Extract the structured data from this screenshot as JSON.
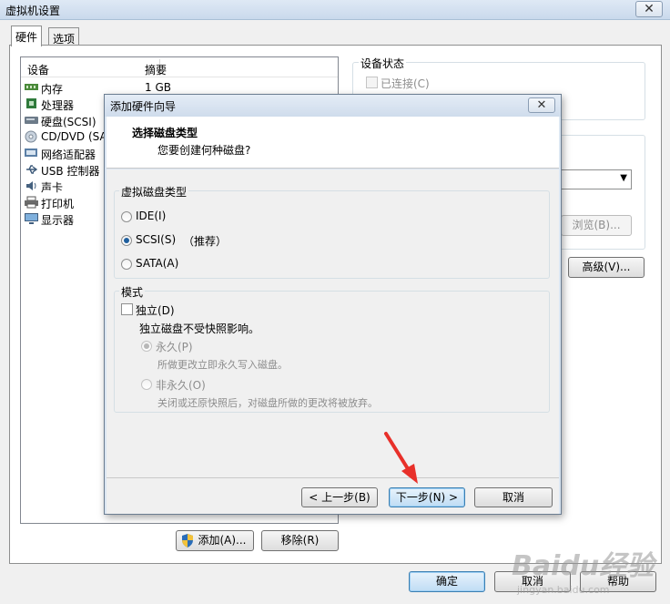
{
  "outer": {
    "title": "虚拟机设置",
    "close": "✕",
    "tabs": [
      "硬件",
      "选项"
    ],
    "device_list": {
      "headers": [
        "设备",
        "摘要"
      ],
      "rows": [
        {
          "name": "内存",
          "summary": "1 GB",
          "icon": "memory-icon"
        },
        {
          "name": "处理器",
          "summary": "",
          "icon": "processor-icon"
        },
        {
          "name": "硬盘(SCSI)",
          "summary": "",
          "icon": "hard-disk-icon"
        },
        {
          "name": "CD/DVD (SA",
          "summary": "",
          "icon": "cd-dvd-icon"
        },
        {
          "name": "网络适配器",
          "summary": "",
          "icon": "network-adapter-icon"
        },
        {
          "name": "USB 控制器",
          "summary": "",
          "icon": "usb-icon"
        },
        {
          "name": "声卡",
          "summary": "",
          "icon": "sound-card-icon"
        },
        {
          "name": "打印机",
          "summary": "",
          "icon": "printer-icon"
        },
        {
          "name": "显示器",
          "summary": "",
          "icon": "display-icon"
        }
      ]
    },
    "device_status": {
      "title": "设备状态",
      "connected": "已连接(C)"
    },
    "browse_label": "浏览(B)...",
    "advanced_label": "高级(V)...",
    "add_label": "添加(A)...",
    "remove_label": "移除(R)",
    "ok_label": "确定",
    "cancel_label": "取消",
    "help_label": "帮助"
  },
  "wizard": {
    "title": "添加硬件向导",
    "close": "✕",
    "heading": "选择磁盘类型",
    "subheading": "您要创建何种磁盘?",
    "disk_type_group": "虚拟磁盘类型",
    "options": [
      {
        "label": "IDE(I)",
        "checked": false
      },
      {
        "label": "SCSI(S)",
        "checked": true,
        "note": "（推荐）"
      },
      {
        "label": "SATA(A)",
        "checked": false
      }
    ],
    "mode_group": "模式",
    "independent_label": "独立(D)",
    "independent_desc": "独立磁盘不受快照影响。",
    "persistent_label": "永久(P)",
    "persistent_desc": "所做更改立即永久写入磁盘。",
    "nonpersistent_label": "非永久(O)",
    "nonpersistent_desc": "关闭或还原快照后，对磁盘所做的更改将被放弃。",
    "back_label": "< 上一步(B)",
    "next_label": "下一步(N) >",
    "cancel_label": "取消"
  },
  "colors": {
    "arrow": "#e8302a",
    "radio_dot": "#1f5f9e"
  },
  "watermark": {
    "text": "Baidu经验",
    "sub": "jingyan.baidu.com"
  }
}
